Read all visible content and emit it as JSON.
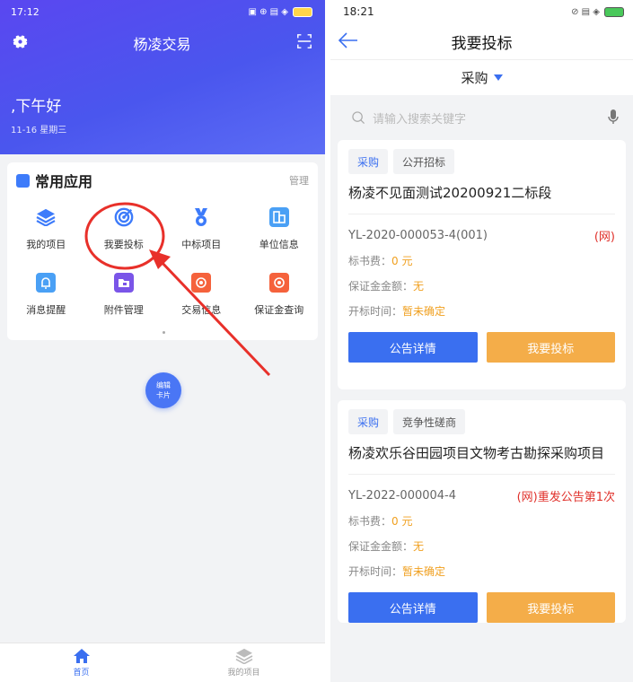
{
  "left": {
    "status": {
      "time": "17:12",
      "icons": "▣ ⊕ ▤ ◈"
    },
    "app_title": "杨凌交易",
    "greeting": ",下午好",
    "date": "11-16 星期三",
    "apps_section": {
      "title": "常用应用",
      "manage": "管理",
      "items": [
        {
          "label": "我的项目",
          "icon": "layers-icon",
          "color": "#3d7bfa"
        },
        {
          "label": "我要投标",
          "icon": "target-icon",
          "color": "#3d7bfa"
        },
        {
          "label": "中标项目",
          "icon": "medal-icon",
          "color": "#3d7bfa"
        },
        {
          "label": "单位信息",
          "icon": "building-icon",
          "color": "#4aa0f5"
        },
        {
          "label": "消息提醒",
          "icon": "bell-icon",
          "color": "#4aa0f5"
        },
        {
          "label": "附件管理",
          "icon": "folder-icon",
          "color": "#7a55e8"
        },
        {
          "label": "交易信息",
          "icon": "record-icon",
          "color": "#f5623c"
        },
        {
          "label": "保证金查询",
          "icon": "record-icon",
          "color": "#f5623c"
        }
      ]
    },
    "edit_button": {
      "line1": "编辑",
      "line2": "卡片"
    },
    "tabbar": [
      {
        "label": "首页",
        "icon": "home-icon"
      },
      {
        "label": "我的项目",
        "icon": "layers-icon"
      }
    ],
    "annotation_color": "#e8302a"
  },
  "right": {
    "status": {
      "time": "18:21"
    },
    "title": "我要投标",
    "filter": "采购",
    "search_placeholder": "请输入搜索关键字",
    "cards": [
      {
        "tag1": "采购",
        "tag2": "公开招标",
        "title": "杨凌不见面测试20200921二标段",
        "code": "YL-2020-000053-4(001)",
        "net": "(网)",
        "fee_label": "标书费：",
        "fee": "0 元",
        "deposit_label": "保证金金额：",
        "deposit": "无",
        "open_label": "开标时间：",
        "open": "暂未确定",
        "btn_detail": "公告详情",
        "btn_bid": "我要投标"
      },
      {
        "tag1": "采购",
        "tag2": "竞争性磋商",
        "title": "杨凌欢乐谷田园项目文物考古勘探采购项目",
        "code": "YL-2022-000004-4",
        "net": "(网)重发公告第1次",
        "fee_label": "标书费：",
        "fee": "0 元",
        "deposit_label": "保证金金额：",
        "deposit": "无",
        "open_label": "开标时间：",
        "open": "暂未确定",
        "btn_detail": "公告详情",
        "btn_bid": "我要投标"
      }
    ]
  }
}
